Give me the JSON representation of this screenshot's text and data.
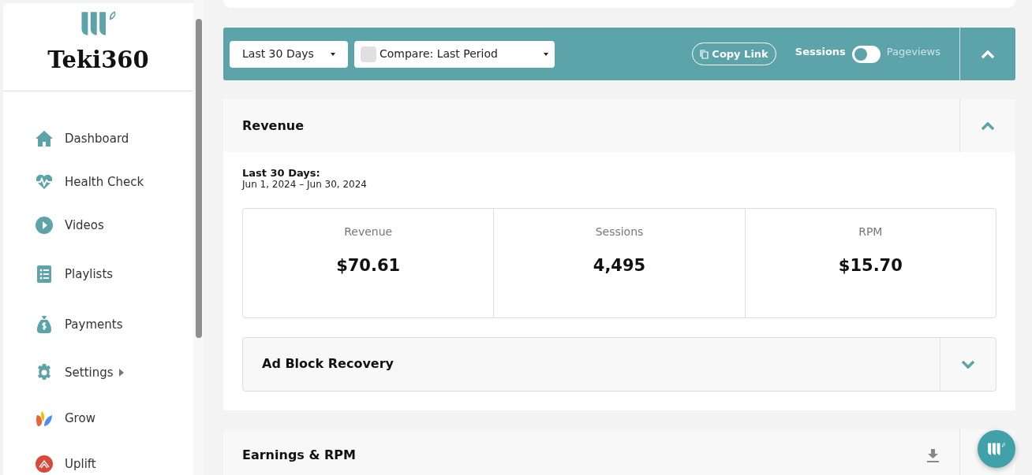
{
  "sidebar": {
    "brand": "Teki360",
    "items": [
      {
        "label": "Dashboard",
        "has_submenu": false
      },
      {
        "label": "Health Check",
        "has_submenu": false
      },
      {
        "label": "Videos",
        "has_submenu": false
      },
      {
        "label": "Playlists",
        "has_submenu": false
      },
      {
        "label": "Payments",
        "has_submenu": false
      },
      {
        "label": "Settings",
        "has_submenu": true
      },
      {
        "label": "Grow",
        "has_submenu": false
      },
      {
        "label": "Uplift",
        "has_submenu": false
      }
    ]
  },
  "toolbar": {
    "date_range": "Last 30 Days",
    "compare": {
      "label": "Compare: Last Period",
      "checked": false
    },
    "copy_link": "Copy Link",
    "toggle": {
      "left": "Sessions",
      "right": "Pageviews",
      "on": false
    },
    "expanded": true
  },
  "revenue": {
    "title": "Revenue",
    "expanded": true,
    "period_label": "Last 30 Days:",
    "period_dates": "Jun 1, 2024 – Jun 30, 2024",
    "metrics": [
      {
        "label": "Revenue",
        "value": "$70.61"
      },
      {
        "label": "Sessions",
        "value": "4,495"
      },
      {
        "label": "RPM",
        "value": "$15.70"
      }
    ],
    "ad_block": {
      "title": "Ad Block Recovery",
      "expanded": false
    }
  },
  "earnings": {
    "title": "Earnings & RPM"
  }
}
